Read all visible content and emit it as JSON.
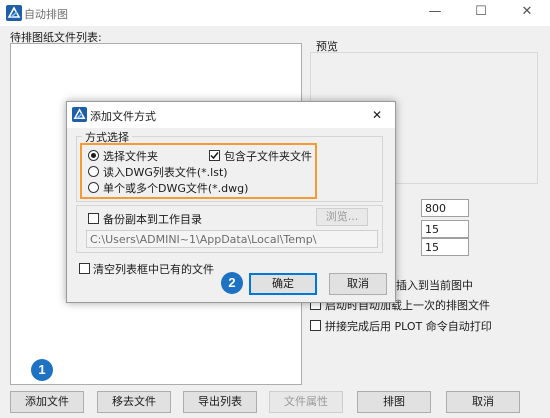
{
  "window": {
    "title": "自动排图",
    "minimize": "—",
    "maximize": "☐",
    "close": "✕"
  },
  "left": {
    "list_label": "待排图纸文件列表:"
  },
  "preview": {
    "label": "预览"
  },
  "settings": {
    "values": [
      "800",
      "15",
      "15"
    ],
    "insert_option": "插入到当前图中",
    "load_last_option": "启动时自动加载上一次的排图文件",
    "auto_plot_option": "拼接完成后用 PLOT 命令自动打印"
  },
  "bottom_buttons": [
    {
      "label": "添加文件",
      "disabled": false
    },
    {
      "label": "移去文件",
      "disabled": false
    },
    {
      "label": "导出列表",
      "disabled": false
    },
    {
      "label": "文件属性",
      "disabled": true
    },
    {
      "label": "排图",
      "disabled": false
    },
    {
      "label": "取消",
      "disabled": false
    }
  ],
  "badges": {
    "one": "1",
    "two": "2"
  },
  "dialog": {
    "title": "添加文件方式",
    "close": "✕",
    "mode_group_label": "方式选择",
    "radio_folder": "选择文件夹",
    "include_subfolders": "包含子文件夹文件",
    "radio_lst": "读入DWG列表文件(*.lst)",
    "radio_dwg": "单个或多个DWG文件(*.dwg)",
    "backup_label": "备份副本到工作目录",
    "browse": "浏览...",
    "path_value": "C:\\Users\\ADMINI~1\\AppData\\Local\\Temp\\",
    "clear_list": "清空列表框中已有的文件",
    "ok": "确定",
    "cancel": "取消"
  },
  "colors": {
    "accent_badge": "#1d72c4",
    "highlight": "#f39c33"
  }
}
